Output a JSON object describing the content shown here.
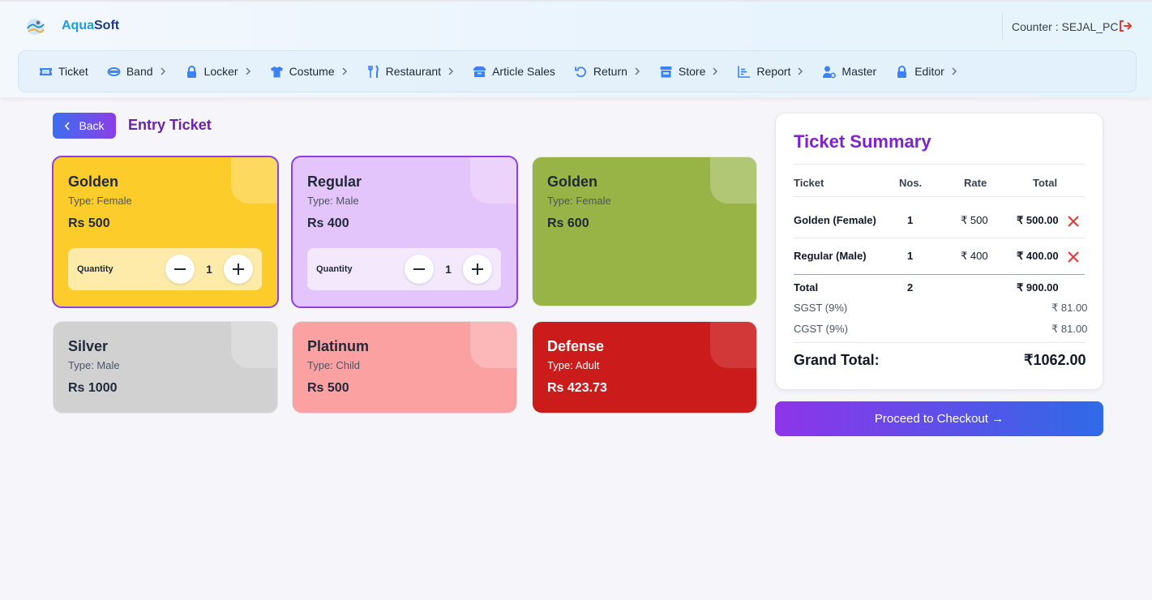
{
  "app": {
    "brand_part1": "Aqua",
    "brand_part2": "Soft",
    "counter": "Counter : SEJAL_PC"
  },
  "nav": [
    {
      "label": "Ticket",
      "icon": "ticket-icon"
    },
    {
      "label": "Band",
      "icon": "band-icon"
    },
    {
      "label": "Locker",
      "icon": "lock-icon"
    },
    {
      "label": "Costume",
      "icon": "shirt-icon"
    },
    {
      "label": "Restaurant",
      "icon": "fork-knife-icon"
    },
    {
      "label": "Article Sales",
      "icon": "box-icon"
    },
    {
      "label": "Return",
      "icon": "undo-icon"
    },
    {
      "label": "Store",
      "icon": "store-icon"
    },
    {
      "label": "Report",
      "icon": "chart-icon"
    },
    {
      "label": "Master",
      "icon": "user-gear-icon"
    },
    {
      "label": "Editor",
      "icon": "lock-icon"
    }
  ],
  "page": {
    "back_label": "Back",
    "title": "Entry Ticket"
  },
  "tickets": [
    {
      "name": "Golden",
      "type": "Type: Female",
      "price": "Rs 500",
      "color": "#fccc2a",
      "selected": true,
      "qty_label": "Quantity",
      "qty": "1"
    },
    {
      "name": "Regular",
      "type": "Type: Male",
      "price": "Rs 400",
      "color": "#e4c5fb",
      "selected": true,
      "qty_label": "Quantity",
      "qty": "1"
    },
    {
      "name": "Golden",
      "type": "Type: Female",
      "price": "Rs 600",
      "color": "#98b447",
      "selected": false
    },
    {
      "name": "Silver",
      "type": "Type: Male",
      "price": "Rs 1000",
      "color": "#d1d1d1",
      "selected": false
    },
    {
      "name": "Platinum",
      "type": "Type: Child",
      "price": "Rs 500",
      "color": "#fba1a2",
      "selected": false
    },
    {
      "name": "Defense",
      "type": "Type: Adult",
      "price": "Rs 423.73",
      "color": "#cc1b1b",
      "selected": false
    }
  ],
  "summary": {
    "title": "Ticket Summary",
    "headers": [
      "Ticket",
      "Nos.",
      "Rate",
      "Total"
    ],
    "rows": [
      {
        "ticket": "Golden (Female)",
        "nos": "1",
        "rate": "₹ 500",
        "total": "₹ 500.00"
      },
      {
        "ticket": "Regular (Male)",
        "nos": "1",
        "rate": "₹ 400",
        "total": "₹ 400.00"
      }
    ],
    "total_label": "Total",
    "total_nos": "2",
    "total_amount": "₹ 900.00",
    "sgst_label": "SGST (9%)",
    "sgst_amount": "₹ 81.00",
    "cgst_label": "CGST (9%)",
    "cgst_amount": "₹ 81.00",
    "grand_label": "Grand Total:",
    "grand_amount": "₹1062.00"
  },
  "checkout_label": "Proceed to Checkout →",
  "colors": {
    "accent_purple": "#7e22ce",
    "accent_blue": "#3b6ef0",
    "danger": "#e53935"
  }
}
